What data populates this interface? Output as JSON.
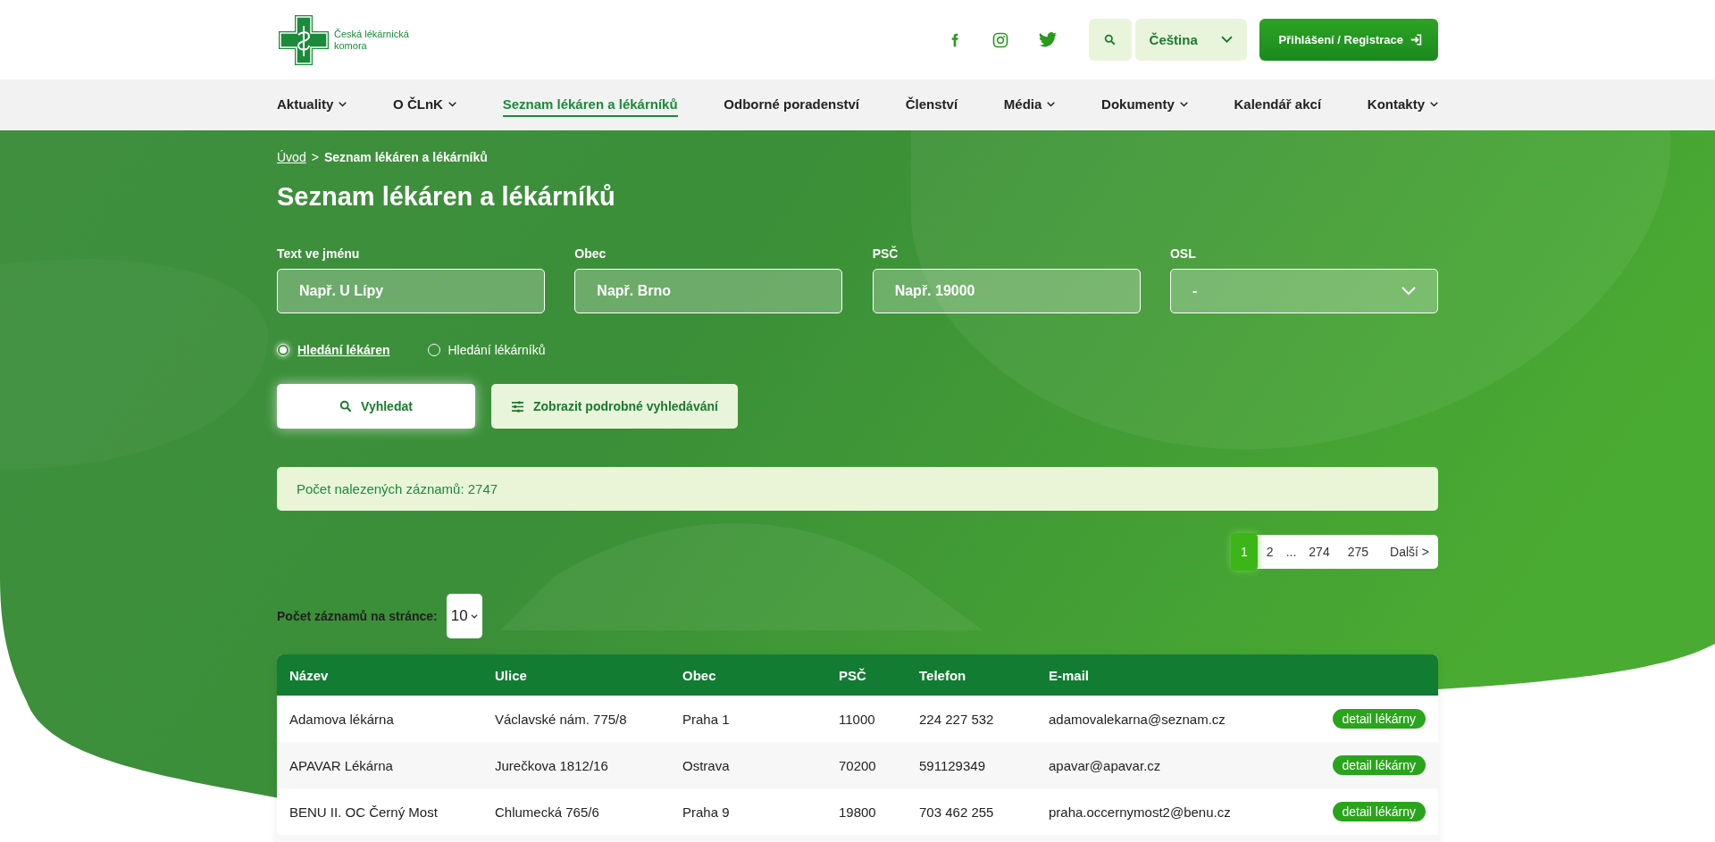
{
  "header": {
    "logo_text": [
      "Česká lékárnická",
      "komora"
    ],
    "language": "Čeština",
    "login_button": "Přihlášení / Registrace"
  },
  "nav": [
    {
      "label": "Aktuality",
      "dropdown": true,
      "selected": false
    },
    {
      "label": "O ČLnK",
      "dropdown": true,
      "selected": false
    },
    {
      "label": "Seznam lékáren a lékárníků",
      "dropdown": false,
      "selected": true
    },
    {
      "label": "Odborné poradenství",
      "dropdown": false,
      "selected": false
    },
    {
      "label": "Členství",
      "dropdown": false,
      "selected": false
    },
    {
      "label": "Média",
      "dropdown": true,
      "selected": false
    },
    {
      "label": "Dokumenty",
      "dropdown": true,
      "selected": false
    },
    {
      "label": "Kalendář akcí",
      "dropdown": false,
      "selected": false
    },
    {
      "label": "Kontakty",
      "dropdown": true,
      "selected": false
    }
  ],
  "breadcrumb": {
    "link": "Úvod",
    "separator": ">",
    "current": "Seznam lékáren a lékárníků"
  },
  "title": "Seznam lékáren a lékárníků",
  "filters": [
    {
      "label": "Text ve jménu",
      "kind": "text",
      "placeholder": "Např. U Lípy"
    },
    {
      "label": "Obec",
      "kind": "text",
      "placeholder": "Např. Brno"
    },
    {
      "label": "PSČ",
      "kind": "text",
      "placeholder": "Např. 19000"
    },
    {
      "label": "OSL",
      "kind": "select",
      "value": "-"
    }
  ],
  "search_modes": [
    {
      "label": "Hledání lékáren",
      "selected": true
    },
    {
      "label": "Hledání lékárníků",
      "selected": false
    }
  ],
  "search_button": "Vyhledat",
  "advanced_button": "Zobrazit podrobné vyhledávání",
  "result_count": "Počet nalezených záznamů: 2747",
  "pagination": [
    {
      "label": "1",
      "kind": "page",
      "selected": true
    },
    {
      "label": "2",
      "kind": "page",
      "selected": false
    },
    {
      "label": "...",
      "kind": "gap"
    },
    {
      "label": "274",
      "kind": "page",
      "selected": false
    },
    {
      "label": "275",
      "kind": "page",
      "selected": false
    },
    {
      "label": "Další >",
      "kind": "next",
      "selected": false
    }
  ],
  "per_page": {
    "label": "Počet záznamů na stránce:",
    "value": "10"
  },
  "table": {
    "columns": [
      "Název",
      "Ulice",
      "Obec",
      "PSČ",
      "Telefon",
      "E-mail"
    ],
    "rows": [
      {
        "cells": [
          "Adamova lékárna",
          "Václavské nám. 775/8",
          "Praha 1",
          "11000",
          "224 227 532",
          "adamovalekarna@seznam.cz"
        ],
        "action": "detail lékárny"
      },
      {
        "cells": [
          "APAVAR Lékárna",
          "Jurečkova 1812/16",
          "Ostrava",
          "70200",
          "591129349",
          "apavar@apavar.cz"
        ],
        "action": "detail lékárny"
      },
      {
        "cells": [
          "BENU II. OC Černý Most",
          "Chlumecká 765/6",
          "Praha 9",
          "19800",
          "703 462 255",
          "praha.occernymost2@benu.cz"
        ],
        "action": "detail lékárny"
      }
    ]
  }
}
